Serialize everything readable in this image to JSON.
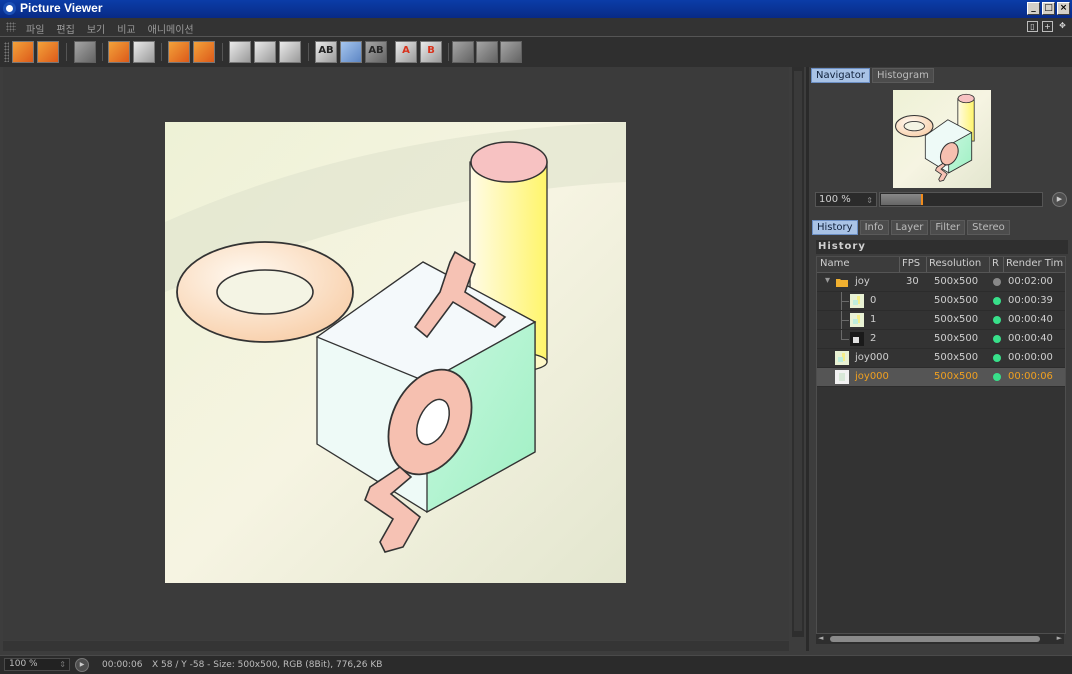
{
  "window": {
    "title": "Picture Viewer"
  },
  "menu": {
    "items": [
      "파일",
      "편집",
      "보기",
      "비교",
      "애니메이션"
    ]
  },
  "toolbar": {
    "ab_label": "AB",
    "a_label": "A",
    "b_label": "B"
  },
  "navigator": {
    "tabs": [
      "Navigator",
      "Histogram"
    ],
    "active_tab": "Navigator",
    "zoom_value": "100 %",
    "zoom_fill_fraction": 0.25
  },
  "history_panel": {
    "tabs": [
      "History",
      "Info",
      "Layer",
      "Filter",
      "Stereo"
    ],
    "active_tab": "History",
    "title": "History",
    "columns": [
      "Name",
      "FPS",
      "Resolution",
      "R",
      "Render Tim"
    ],
    "rows": [
      {
        "name": "joy",
        "fps": "30",
        "resolution": "500x500",
        "status_color": "#888888",
        "render_time": "00:02:00"
      },
      {
        "name": "0",
        "fps": "",
        "resolution": "500x500",
        "status_color": "#38e08a",
        "render_time": "00:00:39"
      },
      {
        "name": "1",
        "fps": "",
        "resolution": "500x500",
        "status_color": "#38e08a",
        "render_time": "00:00:40"
      },
      {
        "name": "2",
        "fps": "",
        "resolution": "500x500",
        "status_color": "#38e08a",
        "render_time": "00:00:40"
      },
      {
        "name": "joy000",
        "fps": "",
        "resolution": "500x500",
        "status_color": "#38e08a",
        "render_time": "00:00:00"
      },
      {
        "name": "joy000",
        "fps": "",
        "resolution": "500x500",
        "status_color": "#38e08a",
        "render_time": "00:00:06"
      }
    ],
    "selected_row": 5,
    "selection_color": "#f0a020"
  },
  "status_bar": {
    "zoom": "100 %",
    "time": "00:00:06",
    "info": "X 58 / Y -58 - Size: 500x500, RGB (8Bit), 776,26 KB"
  },
  "colors": {
    "titlebar": "#0b3da8",
    "accent_orange": "#f08b1c",
    "tab_active": "#a9c3e6"
  }
}
